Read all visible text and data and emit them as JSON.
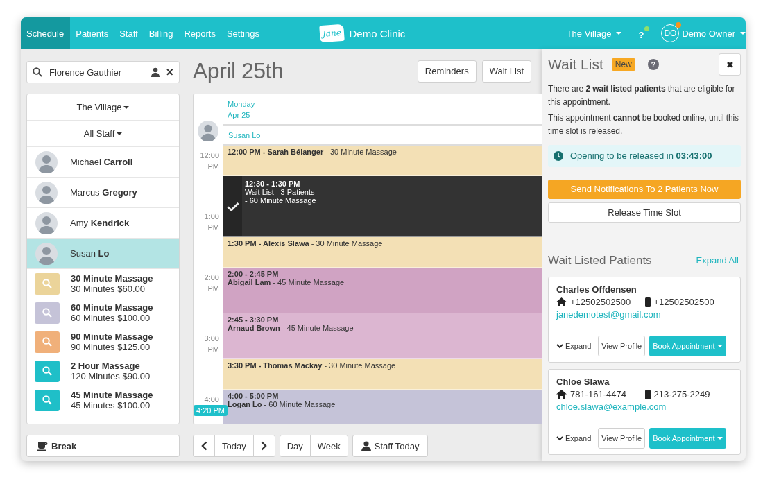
{
  "nav": {
    "tabs": [
      {
        "label": "Schedule",
        "selected": true
      },
      {
        "label": "Patients",
        "selected": false
      },
      {
        "label": "Staff",
        "selected": false
      },
      {
        "label": "Billing",
        "selected": false
      },
      {
        "label": "Reports",
        "selected": false
      },
      {
        "label": "Settings",
        "selected": false
      }
    ],
    "logo_text": "Jane",
    "clinic": "Demo Clinic",
    "location": "The Village",
    "help": "?",
    "help_online": true,
    "user_initials": "DO",
    "user_notification": true,
    "user_name": "Demo Owner"
  },
  "sidebar": {
    "search": {
      "value": "Florence Gauthier",
      "clear": "×"
    },
    "location_filter": "The Village",
    "staff_filter": "All Staff",
    "staff": [
      {
        "name": "Michael **Carroll**",
        "selected": false
      },
      {
        "name": "Marcus **Gregory**",
        "selected": false
      },
      {
        "name": "Amy **Kendrick**",
        "selected": false
      },
      {
        "name": "Susan **Lo**",
        "selected": true
      }
    ],
    "services": [
      {
        "name": "30 Minute Massage",
        "detail": "30 Minutes $60.00",
        "color": "#ebd49a"
      },
      {
        "name": "60 Minute Massage",
        "detail": "60 Minutes $100.00",
        "color": "#c5c3d8"
      },
      {
        "name": "90 Minute Massage",
        "detail": "90 Minutes $125.00",
        "color": "#f0b07a"
      },
      {
        "name": "2 Hour Massage",
        "detail": "120 Minutes $90.00",
        "color": "#1fbfc8"
      },
      {
        "name": "45 Minute Massage",
        "detail": "45 Minutes $100.00",
        "color": "#1fbfc8"
      }
    ],
    "break_button": "Break"
  },
  "schedule": {
    "title": "April 25th",
    "buttons": [
      "Reminders",
      "Wait List"
    ],
    "day": "Monday",
    "date": "Apr 25",
    "staff": "Susan Lo",
    "times": [
      {
        "hour": "12:00",
        "period": "PM"
      },
      {
        "hour": "1:00",
        "period": "PM"
      },
      {
        "hour": "2:00",
        "period": "PM"
      },
      {
        "hour": "3:00",
        "period": "PM"
      },
      {
        "hour": "4:00"
      }
    ],
    "now": "4:20 PM",
    "events": [
      {
        "kind": "single",
        "text": "**12:00 PM - Sarah Bélanger** - 30 Minute Massage",
        "color": "#f3e0b5"
      },
      {
        "kind": "waitlist",
        "title": "12:30 - 1:30 PM",
        "lines": [
          "Wait List - 3 Patients",
          "- 60 Minute Massage"
        ],
        "checked": true,
        "color": "#333333"
      },
      {
        "kind": "single",
        "text": "**1:30 PM - Alexis Slawa** - 30 Minute Massage",
        "color": "#f3e0b5"
      },
      {
        "kind": "double",
        "title": "2:00 - 2:45 PM",
        "text": "**Abigail Lam** - 45 Minute Massage",
        "color": "#d0a3c3"
      },
      {
        "kind": "double",
        "title": "2:45 - 3:30 PM",
        "text": "**Arnaud Brown** - 45 Minute Massage",
        "color": "#dcb6d1"
      },
      {
        "kind": "single",
        "text": "**3:30 PM - Thomas Mackay** - 30 Minute Massage",
        "color": "#f3e0b5"
      },
      {
        "kind": "double",
        "title": "4:00 - 5:00 PM",
        "text": "**Logan Lo** - 60 Minute Massage",
        "color": "#c5c3d8"
      }
    ],
    "toolbar": {
      "today": "Today",
      "views": [
        "Day",
        "Week"
      ],
      "staff_today": "Staff Today"
    }
  },
  "waitlist": {
    "title": "Wait List",
    "badge": "New",
    "help": "?",
    "close": "✖",
    "intro": "There are **2 wait listed patients** that are eligible for this appointment.",
    "note": "This appointment **cannot** be booked online, until this time slot is released.",
    "countdown": "Opening to be released in **03:43:00**",
    "notify_button": "Send Notifications To 2 Patients Now",
    "release_button": "Release Time Slot",
    "patients_heading": "Wait Listed Patients",
    "expand_all": "Expand All",
    "patients": [
      {
        "name": "Charles Offdensen",
        "home": "+12502502500",
        "mobile": "+12502502500",
        "email": "janedemotest@gmail.com",
        "expand": "Expand",
        "profile": "View Profile",
        "book": "Book Appointment"
      },
      {
        "name": "Chloe Slawa",
        "home": "781-161-4474",
        "mobile": "213-275-2249",
        "email": "chloe.slawa@example.com",
        "expand": "Expand",
        "profile": "View Profile",
        "book": "Book Appointment"
      }
    ]
  }
}
